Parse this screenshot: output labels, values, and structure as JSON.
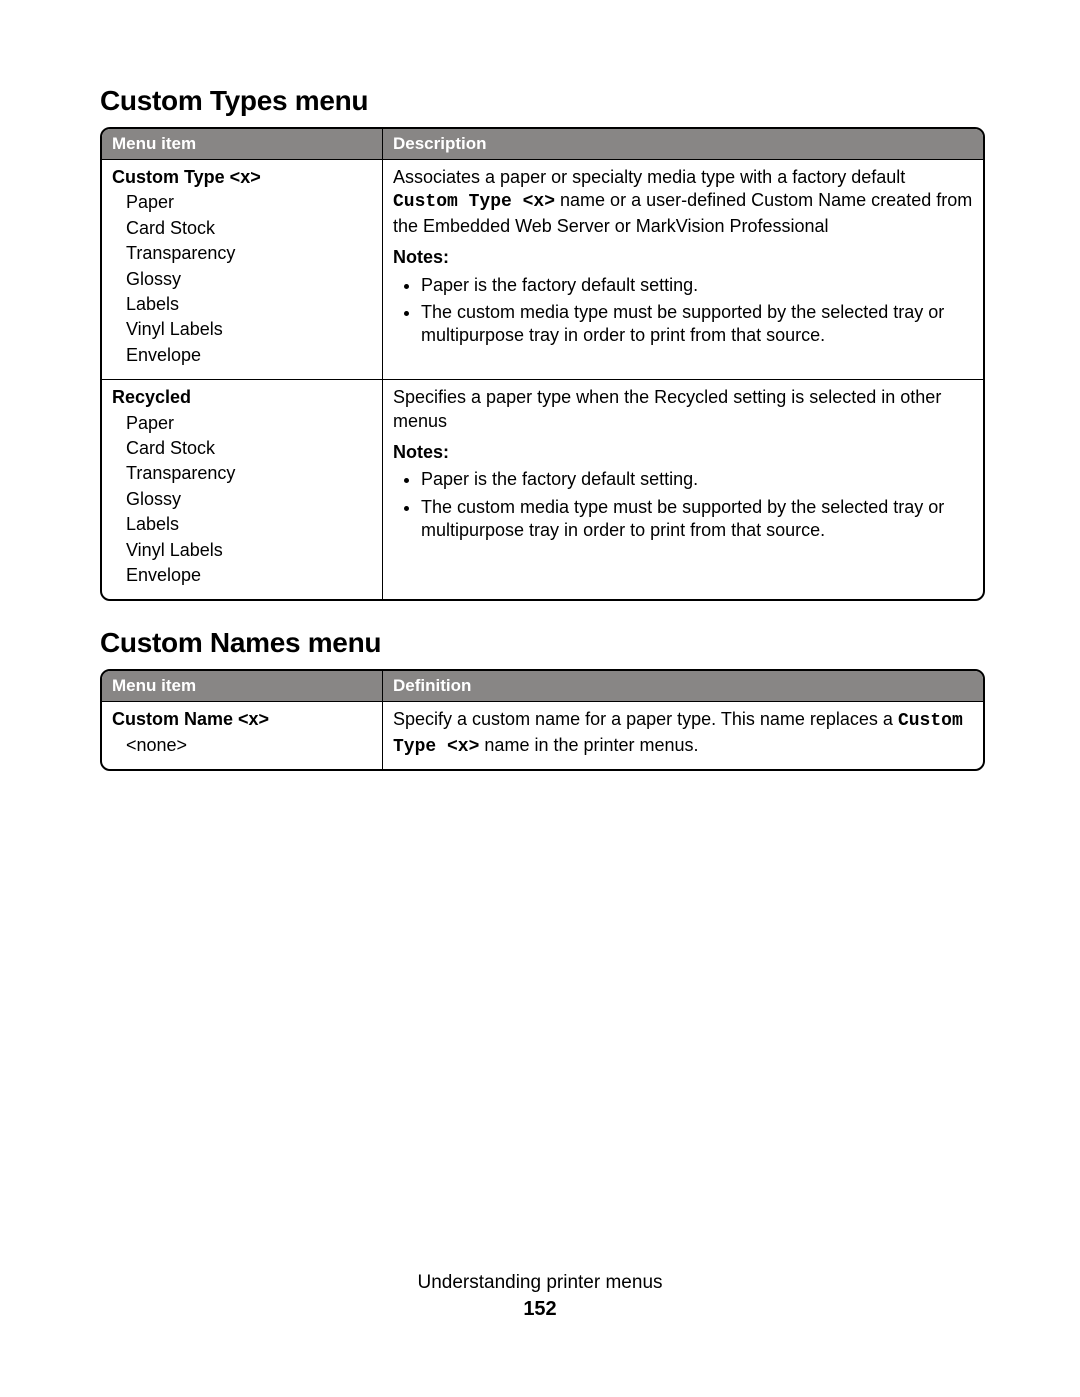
{
  "section1": {
    "heading": "Custom Types menu",
    "header_menu": "Menu item",
    "header_desc": "Description",
    "row1": {
      "title": "Custom Type <x>",
      "options": [
        "Paper",
        "Card Stock",
        "Transparency",
        "Glossy",
        "Labels",
        "Vinyl Labels",
        "Envelope"
      ],
      "desc_pre": "Associates a paper or specialty media type with a factory default ",
      "desc_code": "Custom Type <x>",
      "desc_post": " name or a user-defined Custom Name created from the Embedded Web Server or MarkVision Professional",
      "notes_label": "Notes:",
      "notes": [
        "Paper is the factory default setting.",
        "The custom media type must be supported by the selected tray or multipurpose tray in order to print from that source."
      ]
    },
    "row2": {
      "title": "Recycled",
      "options": [
        "Paper",
        "Card Stock",
        "Transparency",
        "Glossy",
        "Labels",
        "Vinyl Labels",
        "Envelope"
      ],
      "desc": "Specifies a paper type when the Recycled setting is selected in other menus",
      "notes_label": "Notes:",
      "notes": [
        "Paper is the factory default setting.",
        "The custom media type must be supported by the selected tray or multipurpose tray in order to print from that source."
      ]
    }
  },
  "section2": {
    "heading": "Custom Names menu",
    "header_menu": "Menu item",
    "header_desc": "Definition",
    "row1": {
      "title": "Custom Name <x>",
      "option": "<none>",
      "desc_pre": "Specify a custom name for a paper type. This name replaces a ",
      "desc_code": "Custom Type <x>",
      "desc_post": " name in the printer menus."
    }
  },
  "footer": {
    "title": "Understanding printer menus",
    "page": "152"
  }
}
